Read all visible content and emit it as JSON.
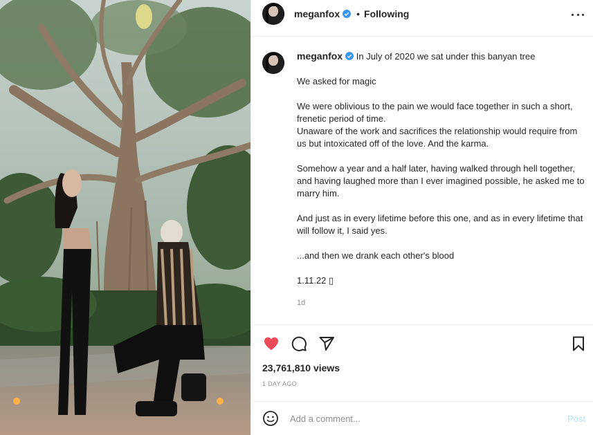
{
  "media": {
    "description_icon": "photo"
  },
  "header": {
    "username": "meganfox",
    "separator": "•",
    "follow_state": "Following",
    "more_icon": "more-horizontal-icon"
  },
  "caption": {
    "username": "meganfox",
    "first_line": "In July of 2020 we sat under this banyan tree",
    "paragraphs": [
      "We asked for magic",
      "We were oblivious to the pain we would face together in such a short, frenetic period of time.\nUnaware of the work and sacrifices the relationship would require from us but intoxicated off of the love. And the karma.",
      "Somehow a year and a half later, having walked through hell together, and having laughed more than I ever imagined possible, he asked me to marry him.",
      "And just as in every lifetime before this one, and as in every lifetime that will follow it, I said yes.",
      "...and then we drank each other's blood",
      "1.11.22 ▯"
    ],
    "time": "1d"
  },
  "actions": {
    "like_icon": "heart-filled-icon",
    "comment_icon": "comment-icon",
    "share_icon": "paper-plane-icon",
    "save_icon": "bookmark-icon",
    "like_color": "#ed4956"
  },
  "stats": {
    "views": "23,761,810 views",
    "posted": "1 DAY AGO"
  },
  "comment": {
    "placeholder": "Add a comment...",
    "post_label": "Post",
    "post_color": "#b2dffc"
  },
  "colors": {
    "verified": "#3897f0",
    "text": "#262626",
    "muted": "#8e8e8e"
  }
}
